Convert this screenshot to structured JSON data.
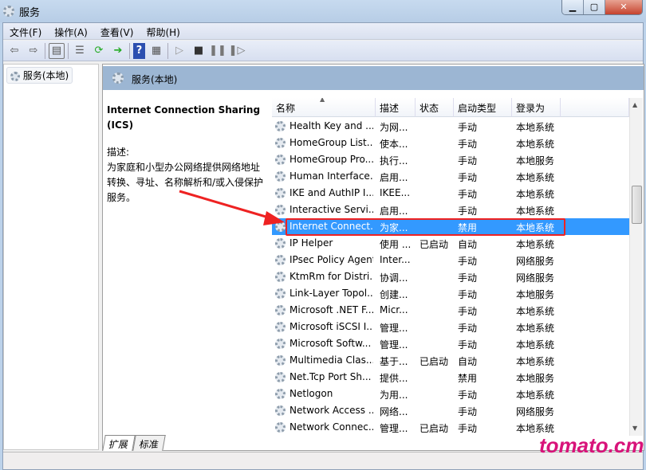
{
  "window": {
    "title": "服务",
    "buttons": [
      "minimize",
      "maximize",
      "close"
    ]
  },
  "menu": [
    "文件(F)",
    "操作(A)",
    "查看(V)",
    "帮助(H)"
  ],
  "toolbar_icons": [
    "back-icon",
    "forward-icon",
    "show-tree-icon",
    "properties-icon",
    "refresh-icon",
    "export-icon",
    "help-icon",
    "console-icon",
    "start-icon",
    "stop-icon",
    "pause-icon",
    "resume-icon"
  ],
  "tree": {
    "root": "服务(本地)"
  },
  "panel": {
    "title": "服务(本地)"
  },
  "details": {
    "service_name": "Internet Connection Sharing (ICS)",
    "desc_label": "描述:",
    "desc_text": "为家庭和小型办公网络提供网络地址转换、寻址、名称解析和/或入侵保护服务。"
  },
  "columns": [
    "名称",
    "描述",
    "状态",
    "启动类型",
    "登录为"
  ],
  "rows": [
    [
      "Health Key and ...",
      "为网...",
      "",
      "手动",
      "本地系统"
    ],
    [
      "HomeGroup List...",
      "使本...",
      "",
      "手动",
      "本地系统"
    ],
    [
      "HomeGroup Pro...",
      "执行...",
      "",
      "手动",
      "本地服务"
    ],
    [
      "Human Interface...",
      "启用...",
      "",
      "手动",
      "本地系统"
    ],
    [
      "IKE and AuthIP I...",
      "IKEE...",
      "",
      "手动",
      "本地系统"
    ],
    [
      "Interactive Servi...",
      "启用...",
      "",
      "手动",
      "本地系统"
    ],
    [
      "Internet Connect...",
      "为家...",
      "",
      "禁用",
      "本地系统"
    ],
    [
      "IP Helper",
      "使用 ...",
      "已启动",
      "自动",
      "本地系统"
    ],
    [
      "IPsec Policy Agent",
      "Inter...",
      "",
      "手动",
      "网络服务"
    ],
    [
      "KtmRm for Distri...",
      "协调...",
      "",
      "手动",
      "网络服务"
    ],
    [
      "Link-Layer Topol...",
      "创建...",
      "",
      "手动",
      "本地服务"
    ],
    [
      "Microsoft .NET F...",
      "Micr...",
      "",
      "手动",
      "本地系统"
    ],
    [
      "Microsoft iSCSI I...",
      "管理...",
      "",
      "手动",
      "本地系统"
    ],
    [
      "Microsoft Softw...",
      "管理...",
      "",
      "手动",
      "本地系统"
    ],
    [
      "Multimedia Clas...",
      "基于...",
      "已启动",
      "自动",
      "本地系统"
    ],
    [
      "Net.Tcp Port Sh...",
      "提供...",
      "",
      "禁用",
      "本地服务"
    ],
    [
      "Netlogon",
      "为用...",
      "",
      "手动",
      "本地系统"
    ],
    [
      "Network Access ...",
      "网络...",
      "",
      "手动",
      "网络服务"
    ],
    [
      "Network Connec...",
      "管理...",
      "已启动",
      "手动",
      "本地系统"
    ]
  ],
  "selected_index": 6,
  "tabs": [
    "扩展",
    "标准"
  ],
  "active_tab": 0,
  "watermark": "tomato.cm",
  "colors": {
    "selection": "#3399ff",
    "highlight_box": "#ee2222",
    "watermark": "#d8137a"
  }
}
